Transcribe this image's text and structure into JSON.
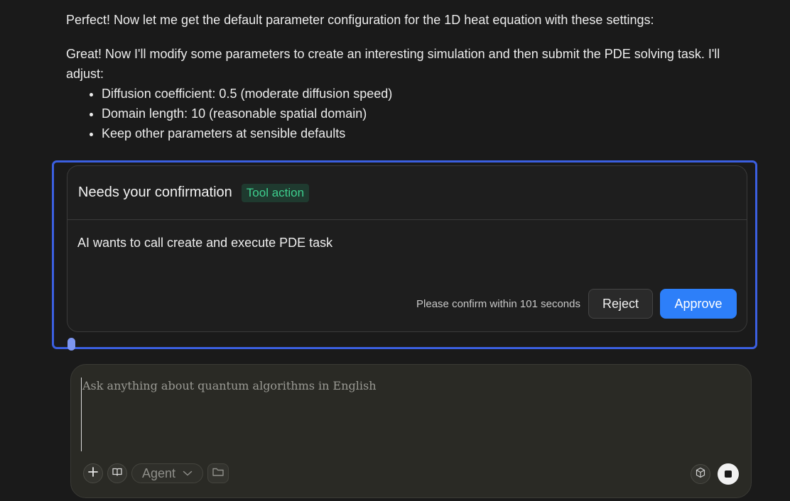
{
  "message": {
    "intro1": "Perfect! Now let me get the default parameter configuration for the 1D heat equation with these settings:",
    "intro2": "Great! Now I'll modify some parameters to create an interesting simulation and then submit the PDE solving task. I'll adjust:",
    "bullets": [
      "Diffusion coefficient: 0.5 (moderate diffusion speed)",
      "Domain length: 10 (reasonable spatial domain)",
      "Keep other parameters at sensible defaults"
    ]
  },
  "confirmation": {
    "title": "Needs your confirmation",
    "badge": "Tool action",
    "body": "AI wants to call create and execute PDE task",
    "countdown": "Please confirm within 101 seconds",
    "reject_label": "Reject",
    "approve_label": "Approve"
  },
  "composer": {
    "placeholder": "Ask anything about quantum algorithms in English",
    "mode_label": "Agent",
    "icons": [
      "plus-icon",
      "book-icon",
      "chevron-down-icon",
      "folder-icon",
      "cube-icon",
      "stop-icon"
    ]
  },
  "colors": {
    "background": "#1a1a1a",
    "focus_border": "#3b5fe0",
    "badge_text": "#3ecf8e",
    "badge_bg": "#1f3a2f",
    "approve": "#2d7ff9",
    "composer_bg": "#2a2a25"
  }
}
